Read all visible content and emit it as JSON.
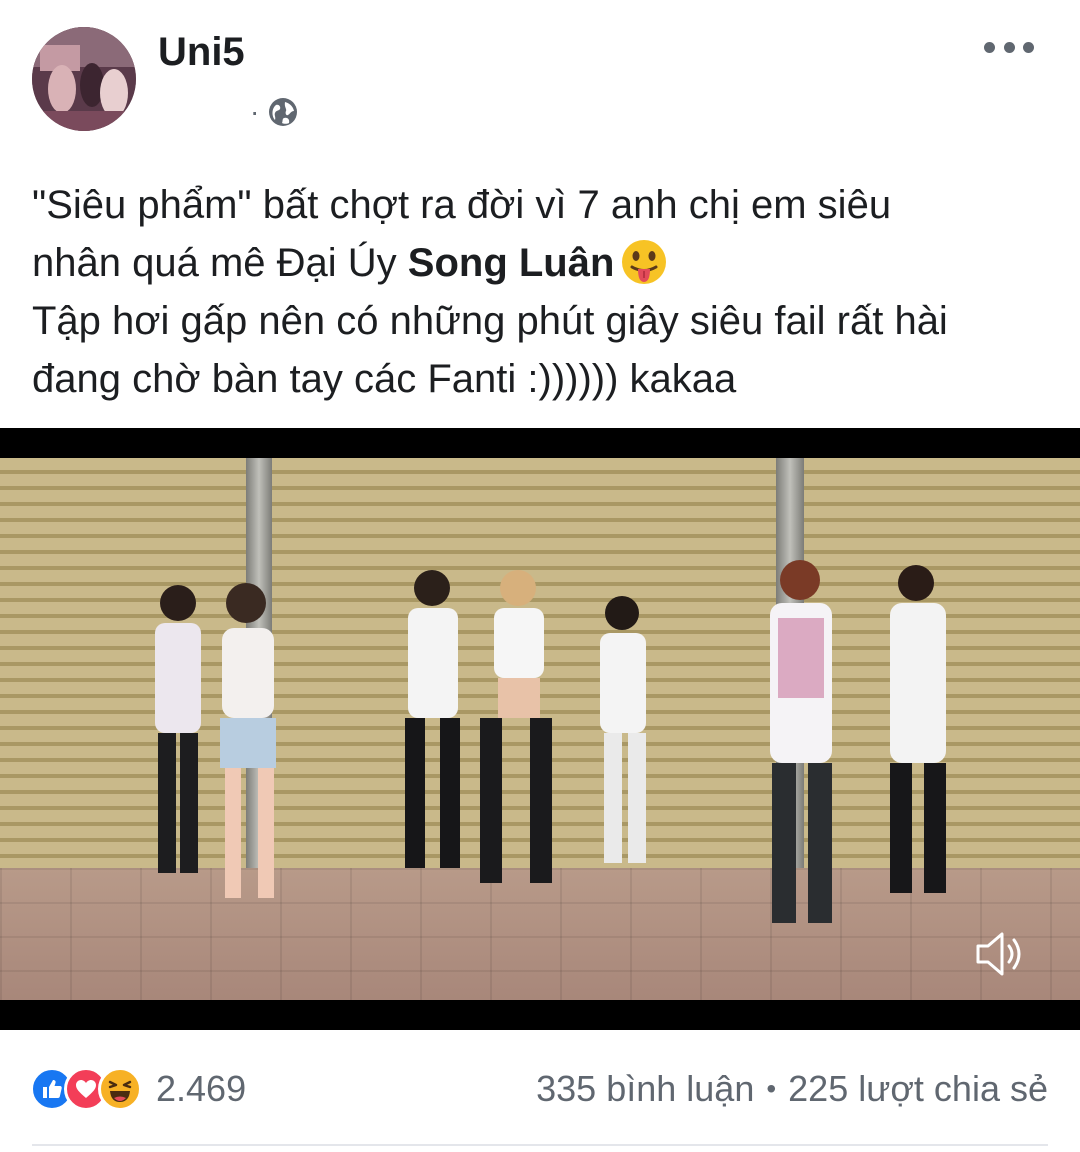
{
  "post": {
    "author": "Uni5",
    "separator": "·",
    "privacy_icon": "globe-icon",
    "more_icon": "more-horizontal-icon",
    "text_lines": [
      "\"Siêu phẩm\" bất chợt ra đời vì 7 anh chị em siêu",
      "nhân quá mê Đại Úy ",
      "Tập hơi gấp nên có những phút giây siêu fail rất hài",
      "đang chờ bàn tay các Fanti :)))))) kakaa"
    ],
    "mention": "Song Luân",
    "emoji": "tongue-out-emoji"
  },
  "video": {
    "volume_icon": "speaker-icon"
  },
  "engagement": {
    "reaction_icons": [
      "like-icon",
      "love-icon",
      "haha-icon"
    ],
    "reaction_count": "2.469",
    "comments": "335 bình luận",
    "stats_separator": "•",
    "shares": "225 lượt chia sẻ"
  },
  "colors": {
    "like": "#1877f2",
    "love": "#f33e58",
    "haha": "#f7b125",
    "text": "#1c1e21",
    "secondary": "#606770"
  }
}
